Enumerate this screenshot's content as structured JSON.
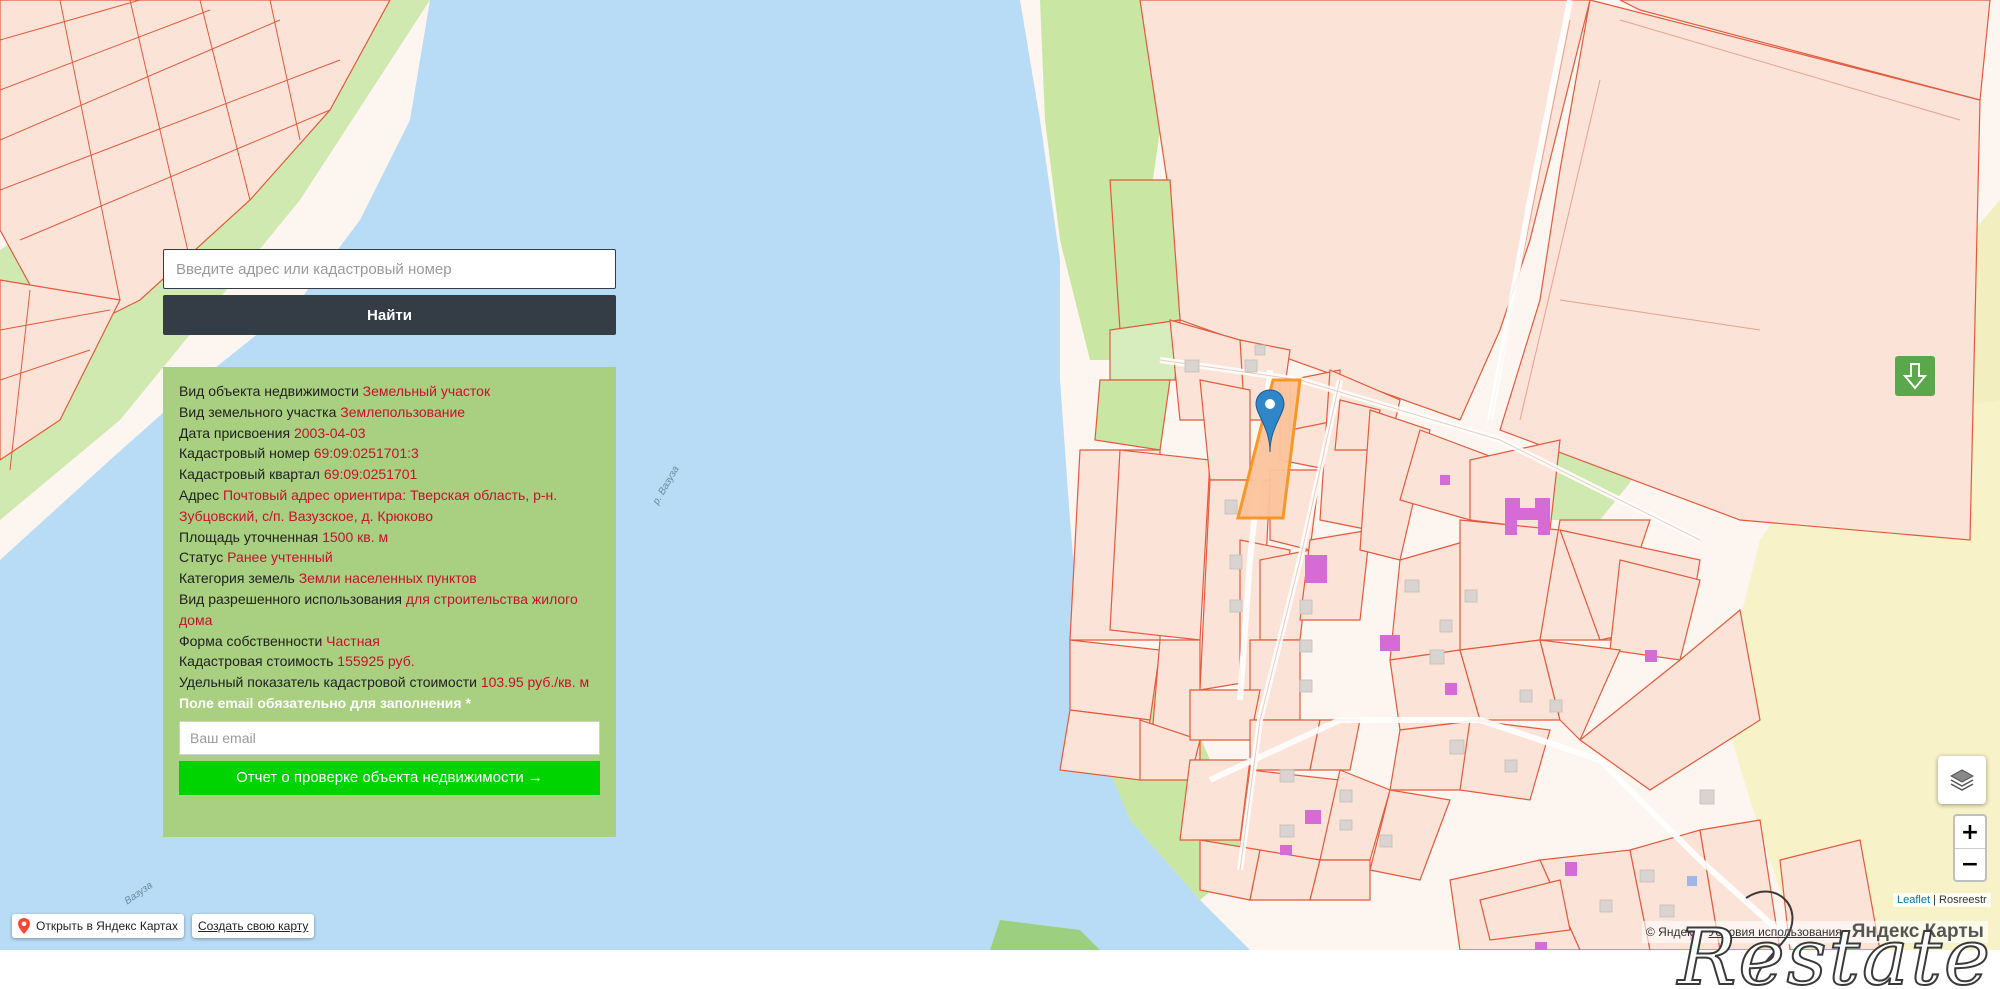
{
  "search": {
    "placeholder": "Введите адрес или кадастровый номер",
    "button_label": "Найти"
  },
  "info": {
    "rows": [
      {
        "label": "Вид объекта недвижимости",
        "value": "Земельный участок"
      },
      {
        "label": "Вид земельного участка",
        "value": "Землепользование"
      },
      {
        "label": "Дата присвоения",
        "value": "2003-04-03"
      },
      {
        "label": "Кадастровый номер",
        "value": "69:09:0251701:3"
      },
      {
        "label": "Кадастровый квартал",
        "value": "69:09:0251701"
      },
      {
        "label": "Адрес",
        "value": "Почтовый адрес ориентира: Тверская область, р-н. Зубцовский, с/п. Вазузское, д. Крюково"
      },
      {
        "label": "Площадь уточненная",
        "value": "1500 кв. м"
      },
      {
        "label": "Статус",
        "value": "Ранее учтенный"
      },
      {
        "label": "Категория земель",
        "value": "Земли населенных пунктов"
      },
      {
        "label": "Вид разрешенного использования",
        "value": "для строительства жилого дома"
      },
      {
        "label": "Форма собственности",
        "value": "Частная"
      },
      {
        "label": "Кадастровая стоимость",
        "value": "155925 руб."
      },
      {
        "label": "Удельный показатель кадастровой стоимости",
        "value": "103.95 руб./кв. м"
      }
    ],
    "email_label": "Поле email обязательно для заполнения *",
    "email_placeholder": "Ваш email",
    "report_button": "Отчет о проверке объекта недвижимости →"
  },
  "map_labels": {
    "river_1": "р. Вазуза",
    "river_2": "Вазуза"
  },
  "yandex": {
    "open_label": "Открыть в Яндекс Картах",
    "create_label": "Создать свою карту",
    "copyright": "© Яндекс",
    "terms": "Условия использования",
    "brand": "Яндекс Карты"
  },
  "attribution": {
    "leaflet": "Leaflet",
    "separator": " | ",
    "source": "Rosreestr"
  },
  "zoom": {
    "in": "+",
    "out": "−"
  },
  "watermark": {
    "text": "Restate"
  },
  "colors": {
    "water": "#b8dcf5",
    "land": "#fdf5ef",
    "parcel_fill": "#fbe3d8",
    "parcel_stroke": "#e35a3c",
    "green": "#c9e6a3",
    "selected": "#f7941d",
    "building": "#d66bd6",
    "card": "#a8d080",
    "button_dark": "#343d46",
    "button_green": "#00d400",
    "value_red": "#c8102e",
    "marker": "#2f86c8"
  }
}
